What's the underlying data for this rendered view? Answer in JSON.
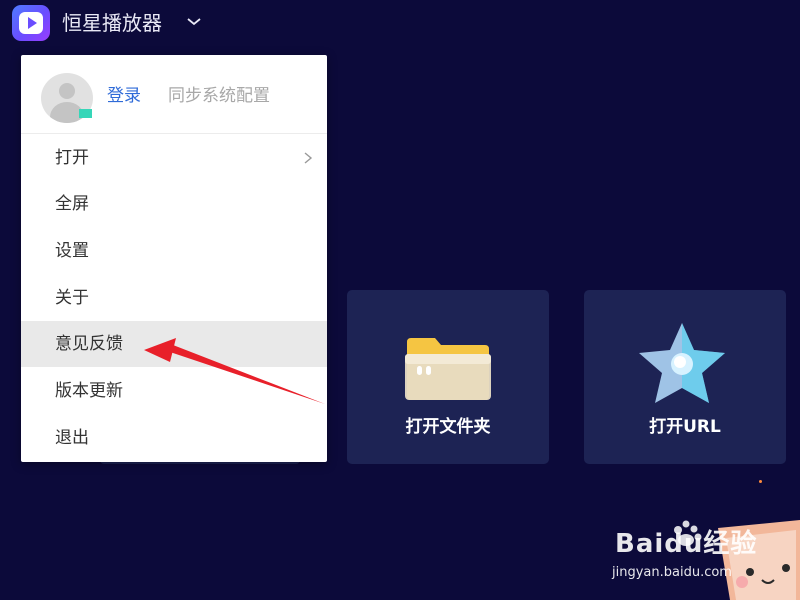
{
  "app": {
    "title": "恒星播放器"
  },
  "menu": {
    "login_label": "登录",
    "sync_label": "同步系统配置",
    "items": [
      {
        "label": "打开",
        "has_submenu": true
      },
      {
        "label": "全屏"
      },
      {
        "label": "设置"
      },
      {
        "label": "关于"
      },
      {
        "label": "意见反馈",
        "highlighted": true
      },
      {
        "label": "版本更新"
      },
      {
        "label": "退出"
      }
    ]
  },
  "cards": [
    {
      "label": "打开文件夹",
      "icon": "folder-icon"
    },
    {
      "label": "打开URL",
      "icon": "star-icon"
    }
  ],
  "watermark": {
    "brand": "Baidu经验",
    "url": "jingyan.baidu.com"
  },
  "colors": {
    "background": "#0c0a3a",
    "card": "#1d2354",
    "accent_link": "#2f6bd8",
    "annotation_arrow": "#e8202a",
    "highlight_row": "#e9e9e9"
  }
}
